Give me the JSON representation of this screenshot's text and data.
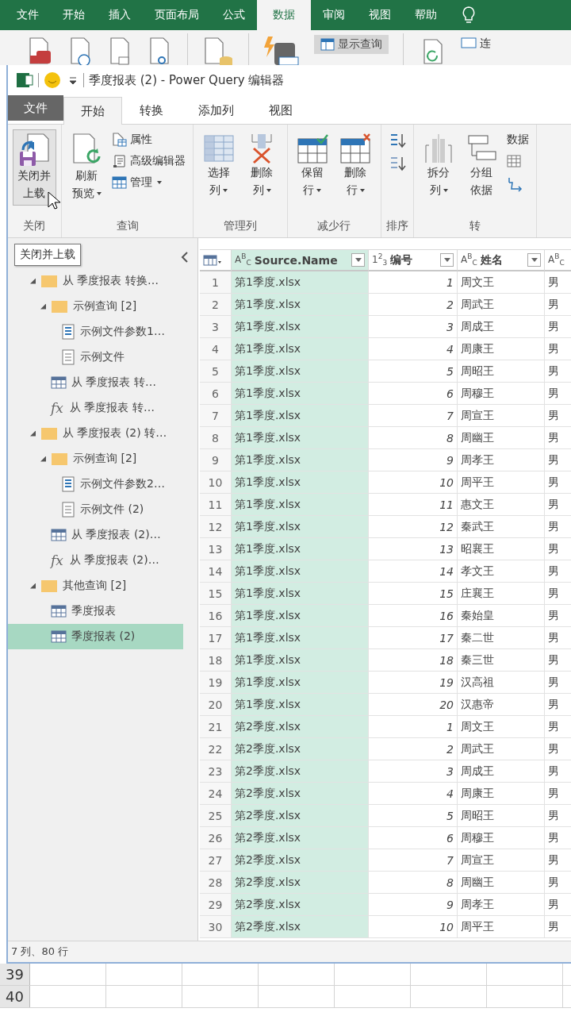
{
  "excel": {
    "tabs": [
      {
        "label": "文件",
        "selected": false
      },
      {
        "label": "开始",
        "selected": false
      },
      {
        "label": "插入",
        "selected": false
      },
      {
        "label": "页面布局",
        "selected": false
      },
      {
        "label": "公式",
        "selected": false
      },
      {
        "label": "数据",
        "selected": true
      },
      {
        "label": "审阅",
        "selected": false
      },
      {
        "label": "视图",
        "selected": false
      },
      {
        "label": "帮助",
        "selected": false
      }
    ],
    "ribbon": {
      "show_queries": "显示查询",
      "cut_label": "连"
    }
  },
  "editor": {
    "title": "季度报表 (2) - Power Query 编辑器",
    "file_tab": "文件",
    "tabs": [
      {
        "label": "开始",
        "selected": true
      },
      {
        "label": "转换",
        "selected": false
      },
      {
        "label": "添加列",
        "selected": false
      },
      {
        "label": "视图",
        "selected": false
      }
    ],
    "ribbon": {
      "groups": [
        {
          "label": "关闭",
          "items": [
            {
              "kind": "large",
              "label": "关闭并上载",
              "dropdown": false,
              "hovered": true
            }
          ]
        },
        {
          "label": "查询",
          "items": [
            {
              "kind": "large",
              "label": "刷新预览",
              "dropdown": true,
              "hovered": false
            },
            {
              "kind": "small",
              "label": "属性",
              "dropdown": false,
              "hovered": false
            },
            {
              "kind": "small",
              "label": "高级编辑器",
              "dropdown": false,
              "hovered": false
            },
            {
              "kind": "small",
              "label": "管理",
              "dropdown": true,
              "hovered": false
            }
          ]
        },
        {
          "label": "管理列",
          "items": [
            {
              "kind": "large",
              "label": "选择列",
              "dropdown": true,
              "hovered": false
            },
            {
              "kind": "large",
              "label": "删除列",
              "dropdown": true,
              "hovered": false
            }
          ]
        },
        {
          "label": "减少行",
          "items": [
            {
              "kind": "large",
              "label": "保留行",
              "dropdown": true,
              "hovered": false
            },
            {
              "kind": "large",
              "label": "删除行",
              "dropdown": true,
              "hovered": false
            }
          ]
        },
        {
          "label": "排序",
          "items": [
            {
              "kind": "small",
              "dropdown": false,
              "hovered": false
            },
            {
              "kind": "small",
              "dropdown": false,
              "hovered": false
            }
          ]
        },
        {
          "label": "转",
          "items": [
            {
              "kind": "large",
              "label": "拆分列",
              "dropdown": true,
              "hovered": false
            },
            {
              "kind": "large",
              "label": "分组依据",
              "dropdown": false,
              "hovered": false
            },
            {
              "kind": "small",
              "label": "数据",
              "dropdown": false,
              "hovered": false
            },
            {
              "kind": "small",
              "dropdown": false,
              "hovered": false
            },
            {
              "kind": "small",
              "dropdown": false,
              "hovered": false
            }
          ]
        }
      ]
    },
    "tooltip": "关闭并上载",
    "queries": [
      {
        "kind": "folder",
        "label": "从 季度报表 转换…",
        "expanded": true,
        "selected": false,
        "children": [
          {
            "kind": "folder",
            "label": "示例查询 [2]",
            "expanded": true,
            "selected": false,
            "children": [
              {
                "kind": "parameter",
                "label": "示例文件参数1…",
                "selected": false
              },
              {
                "kind": "file",
                "label": "示例文件",
                "selected": false
              }
            ]
          },
          {
            "kind": "table",
            "label": "从 季度报表 转…",
            "selected": false
          },
          {
            "kind": "function",
            "symbol": "fx",
            "label": "从 季度报表 转…",
            "selected": false
          }
        ]
      },
      {
        "kind": "folder",
        "label": "从 季度报表 (2) 转…",
        "expanded": true,
        "selected": false,
        "children": [
          {
            "kind": "folder",
            "label": "示例查询 [2]",
            "expanded": true,
            "selected": false,
            "children": [
              {
                "kind": "parameter",
                "label": "示例文件参数2…",
                "selected": false
              },
              {
                "kind": "file",
                "label": "示例文件 (2)",
                "selected": false
              }
            ]
          },
          {
            "kind": "table",
            "label": "从 季度报表 (2)…",
            "selected": false
          },
          {
            "kind": "function",
            "symbol": "fx",
            "label": "从 季度报表 (2)…",
            "selected": false
          }
        ]
      },
      {
        "kind": "folder",
        "label": "其他查询 [2]",
        "expanded": true,
        "selected": false,
        "children": [
          {
            "kind": "table",
            "label": "季度报表",
            "selected": false
          },
          {
            "kind": "table",
            "label": "季度报表 (2)",
            "selected": true
          }
        ]
      }
    ],
    "table": {
      "columns": [
        {
          "type_label": "A$^{B}$$_{C}$",
          "name": "Source.Name",
          "selected": true
        },
        {
          "type_label": "1$^{2}$$_{3}$",
          "name": "编号",
          "selected": false
        },
        {
          "type_label": "A$^{B}$$_{C}$",
          "name": "姓名",
          "selected": false
        },
        {
          "type_label": "A$^{B}$$_{C}$",
          "selected": false
        }
      ],
      "rows": [
        {
          "num": "1",
          "cells": [
            "第1季度.xlsx",
            "1",
            "周文王",
            "男"
          ]
        },
        {
          "num": "2",
          "cells": [
            "第1季度.xlsx",
            "2",
            "周武王",
            "男"
          ]
        },
        {
          "num": "3",
          "cells": [
            "第1季度.xlsx",
            "3",
            "周成王",
            "男"
          ]
        },
        {
          "num": "4",
          "cells": [
            "第1季度.xlsx",
            "4",
            "周康王",
            "男"
          ]
        },
        {
          "num": "5",
          "cells": [
            "第1季度.xlsx",
            "5",
            "周昭王",
            "男"
          ]
        },
        {
          "num": "6",
          "cells": [
            "第1季度.xlsx",
            "6",
            "周穆王",
            "男"
          ]
        },
        {
          "num": "7",
          "cells": [
            "第1季度.xlsx",
            "7",
            "周宣王",
            "男"
          ]
        },
        {
          "num": "8",
          "cells": [
            "第1季度.xlsx",
            "8",
            "周幽王",
            "男"
          ]
        },
        {
          "num": "9",
          "cells": [
            "第1季度.xlsx",
            "9",
            "周孝王",
            "男"
          ]
        },
        {
          "num": "10",
          "cells": [
            "第1季度.xlsx",
            "10",
            "周平王",
            "男"
          ]
        },
        {
          "num": "11",
          "cells": [
            "第1季度.xlsx",
            "11",
            "惠文王",
            "男"
          ]
        },
        {
          "num": "12",
          "cells": [
            "第1季度.xlsx",
            "12",
            "秦武王",
            "男"
          ]
        },
        {
          "num": "13",
          "cells": [
            "第1季度.xlsx",
            "13",
            "昭襄王",
            "男"
          ]
        },
        {
          "num": "14",
          "cells": [
            "第1季度.xlsx",
            "14",
            "孝文王",
            "男"
          ]
        },
        {
          "num": "15",
          "cells": [
            "第1季度.xlsx",
            "15",
            "庄襄王",
            "男"
          ]
        },
        {
          "num": "16",
          "cells": [
            "第1季度.xlsx",
            "16",
            "秦始皇",
            "男"
          ]
        },
        {
          "num": "17",
          "cells": [
            "第1季度.xlsx",
            "17",
            "秦二世",
            "男"
          ]
        },
        {
          "num": "18",
          "cells": [
            "第1季度.xlsx",
            "18",
            "秦三世",
            "男"
          ]
        },
        {
          "num": "19",
          "cells": [
            "第1季度.xlsx",
            "19",
            "汉高祖",
            "男"
          ]
        },
        {
          "num": "20",
          "cells": [
            "第1季度.xlsx",
            "20",
            "汉惠帝",
            "男"
          ]
        },
        {
          "num": "21",
          "cells": [
            "第2季度.xlsx",
            "1",
            "周文王",
            "男"
          ]
        },
        {
          "num": "22",
          "cells": [
            "第2季度.xlsx",
            "2",
            "周武王",
            "男"
          ]
        },
        {
          "num": "23",
          "cells": [
            "第2季度.xlsx",
            "3",
            "周成王",
            "男"
          ]
        },
        {
          "num": "24",
          "cells": [
            "第2季度.xlsx",
            "4",
            "周康王",
            "男"
          ]
        },
        {
          "num": "25",
          "cells": [
            "第2季度.xlsx",
            "5",
            "周昭王",
            "男"
          ]
        },
        {
          "num": "26",
          "cells": [
            "第2季度.xlsx",
            "6",
            "周穆王",
            "男"
          ]
        },
        {
          "num": "27",
          "cells": [
            "第2季度.xlsx",
            "7",
            "周宣王",
            "男"
          ]
        },
        {
          "num": "28",
          "cells": [
            "第2季度.xlsx",
            "8",
            "周幽王",
            "男"
          ]
        },
        {
          "num": "29",
          "cells": [
            "第2季度.xlsx",
            "9",
            "周孝王",
            "男"
          ]
        },
        {
          "num": "30",
          "cells": [
            "第2季度.xlsx",
            "10",
            "周平王",
            "男"
          ]
        }
      ]
    },
    "status": "7 列、80 行"
  },
  "sheet": {
    "rows": [
      "39",
      "40"
    ]
  }
}
